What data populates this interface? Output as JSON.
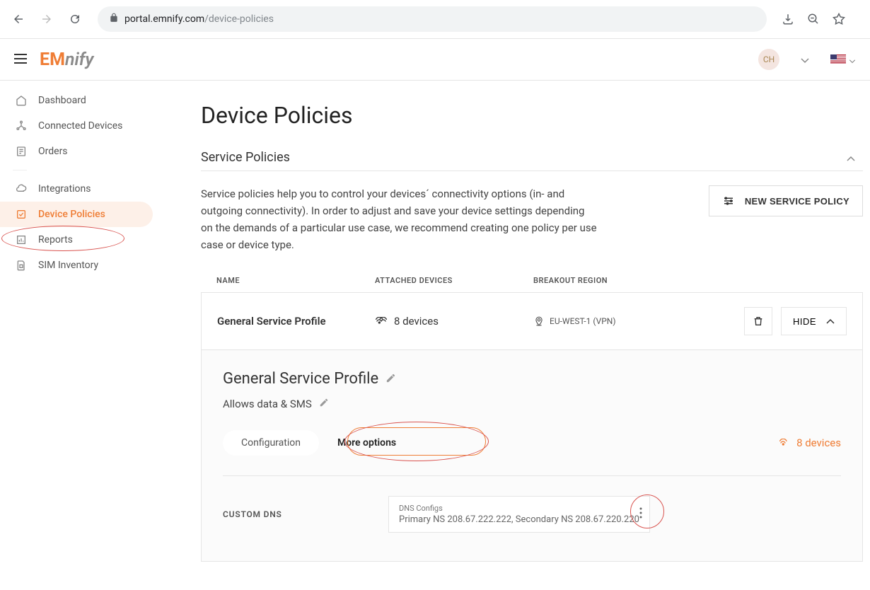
{
  "browser": {
    "domain": "portal.emnify.com",
    "path": "/device-policies"
  },
  "logo": {
    "part1": "EM",
    "part2": "nify"
  },
  "avatar": "CH",
  "sidebar": {
    "items": [
      {
        "label": "Dashboard"
      },
      {
        "label": "Connected Devices"
      },
      {
        "label": "Orders"
      },
      {
        "label": "Integrations"
      },
      {
        "label": "Device Policies"
      },
      {
        "label": "Reports"
      },
      {
        "label": "SIM Inventory"
      }
    ]
  },
  "page": {
    "title": "Device Policies",
    "section_title": "Service Policies",
    "section_desc": "Service policies help you to control your devices´ connectivity options (in- and outgoing connectivity). In order to adjust and save your device settings depending on the demands of a particular use case, we recommend creating one policy per use case or device type.",
    "new_policy_label": "NEW SERVICE POLICY"
  },
  "table": {
    "headers": {
      "name": "NAME",
      "devices": "ATTACHED DEVICES",
      "region": "BREAKOUT REGION"
    },
    "rows": [
      {
        "name": "General Service Profile",
        "devices": "8 devices",
        "region": "EU-WEST-1 (VPN)",
        "hide_label": "HIDE"
      }
    ]
  },
  "expanded": {
    "title": "General Service Profile",
    "subtitle": "Allows data & SMS",
    "tabs": {
      "config": "Configuration",
      "more": "More options"
    },
    "devices_link": "8 devices",
    "dns": {
      "label": "CUSTOM DNS",
      "box_label": "DNS Configs",
      "box_value": "Primary NS 208.67.222.222, Secondary NS 208.67.220.220"
    }
  }
}
